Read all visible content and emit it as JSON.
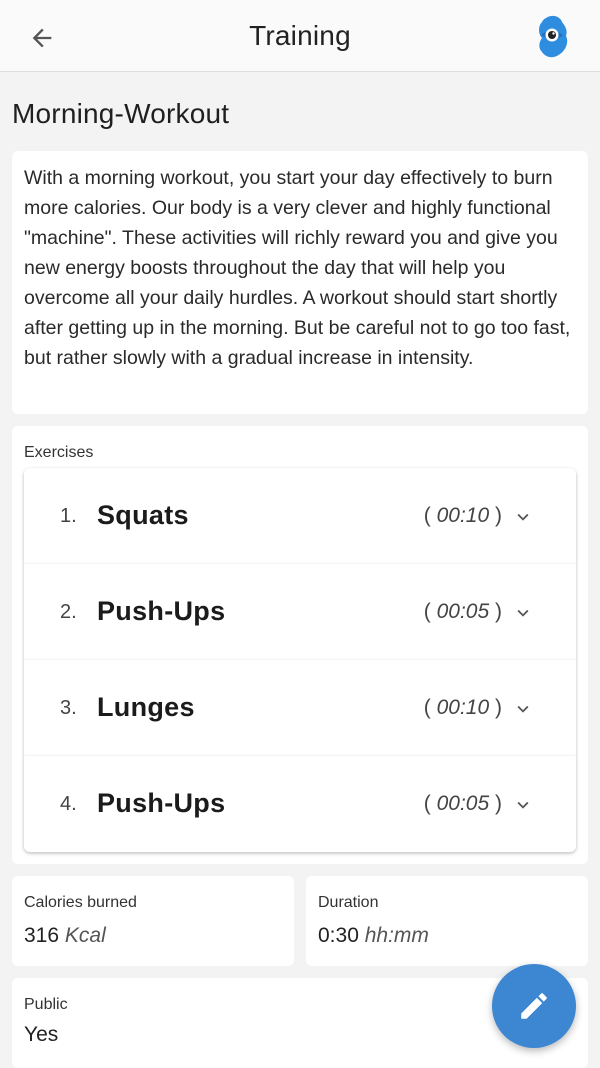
{
  "appbar": {
    "title": "Training",
    "back_icon": "arrow-left-icon",
    "logo_icon": "app-logo-icon"
  },
  "workout": {
    "title": "Morning-Workout",
    "description": "With a morning workout, you start your day effectively to burn more calories. Our body is a very clever and highly functional \"machine\". These activities will richly reward you and give you new energy boosts throughout the day that will help you overcome all your daily hurdles. A workout should start shortly after getting up in the morning. But be careful not to go too fast, but rather slowly with a gradual increase in intensity."
  },
  "exercises": {
    "label": "Exercises",
    "items": [
      {
        "number": "1.",
        "name": "Squats",
        "duration": "00:10"
      },
      {
        "number": "2.",
        "name": "Push-Ups",
        "duration": "00:05"
      },
      {
        "number": "3.",
        "name": "Lunges",
        "duration": "00:10"
      },
      {
        "number": "4.",
        "name": "Push-Ups",
        "duration": "00:05"
      }
    ]
  },
  "stats": {
    "calories": {
      "label": "Calories burned",
      "value": "316",
      "unit": "Kcal"
    },
    "duration": {
      "label": "Duration",
      "value": "0:30",
      "unit": "hh:mm"
    },
    "public": {
      "label": "Public",
      "value": "Yes"
    }
  },
  "fab": {
    "icon": "pencil-edit-icon"
  },
  "colors": {
    "accent": "#3d86d2",
    "background": "#f3f3f3",
    "card": "#ffffff"
  }
}
